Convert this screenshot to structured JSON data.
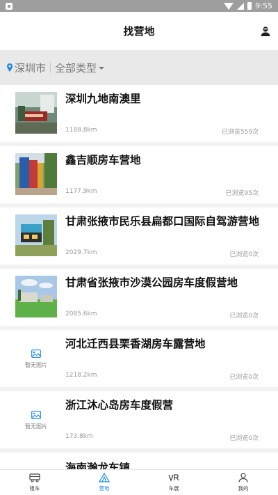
{
  "status_bar": {
    "time": "9:55"
  },
  "header": {
    "title": "找营地"
  },
  "filter": {
    "city": "深圳市",
    "type": "全部类型"
  },
  "camps": [
    {
      "name": "深圳九地南澳里",
      "distance": "1188.8km",
      "views": "已浏览559次",
      "has_image": true
    },
    {
      "name": "鑫吉顺房车营地",
      "distance": "1177.9km",
      "views": "已浏览95次",
      "has_image": true
    },
    {
      "name": "甘肃张掖市民乐县扁都口国际自驾游营地",
      "distance": "2029.7km",
      "views": "已浏览0次",
      "has_image": true
    },
    {
      "name": "甘肃省张掖市沙漠公园房车度假营地",
      "distance": "2085.6km",
      "views": "已浏览0次",
      "has_image": true
    },
    {
      "name": "河北迁西县栗香湖房车露营地",
      "distance": "1218.2km",
      "views": "已浏览0次",
      "has_image": false
    },
    {
      "name": "浙江沐心岛房车度假营",
      "distance": "173.8km",
      "views": "已浏览0次",
      "has_image": false
    },
    {
      "name": "海南瀚龙车镇",
      "distance": "",
      "views": "",
      "has_image": false
    }
  ],
  "no_image_label": "暂无图片",
  "tabs": [
    {
      "label": "租车",
      "icon": "rv-icon",
      "active": false
    },
    {
      "label": "营地",
      "icon": "tent-icon",
      "active": true
    },
    {
      "label": "车展",
      "icon": "vr-icon",
      "active": false
    },
    {
      "label": "我的",
      "icon": "person-icon",
      "active": false
    }
  ],
  "colors": {
    "accent": "#1e88e5",
    "filter_bg": "#e9e9e9",
    "status_bg": "#9e9e9e"
  }
}
